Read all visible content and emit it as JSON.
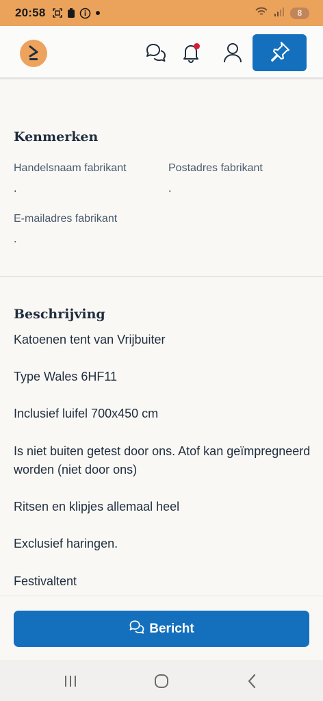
{
  "status_bar": {
    "time": "20:58",
    "battery": "8",
    "icons": [
      "screenshot-icon",
      "lock-icon",
      "info-icon",
      "dot-icon",
      "wifi-icon",
      "signal-icon"
    ]
  },
  "header": {
    "logo": "marktplaats-logo",
    "icons": [
      "chat-icon",
      "bell-icon",
      "user-icon",
      "pin-icon"
    ],
    "colors": {
      "accent": "#1470bd",
      "logo": "#eda25d",
      "notification": "#d81b3a"
    }
  },
  "kenmerken": {
    "title": "Kenmerken",
    "fields": [
      {
        "label": "Handelsnaam fabrikant",
        "value": "."
      },
      {
        "label": "Postadres fabrikant",
        "value": "."
      },
      {
        "label": "E-mailadres fabrikant",
        "value": "."
      }
    ]
  },
  "beschrijving": {
    "title": "Beschrijving",
    "lines": [
      "Katoenen tent van Vrijbuiter",
      "Type Wales 6HF11",
      "Inclusief luifel 700x450 cm",
      "Is niet buiten getest door ons. Atof kan geïmpregneerd worden (niet door ons)",
      "Ritsen en klipjes allemaal heel",
      "Exclusief haringen.",
      "Festivaltent"
    ]
  },
  "action": {
    "message_label": "Bericht"
  },
  "nav": {
    "items": [
      "recent-apps-icon",
      "home-icon",
      "back-icon"
    ]
  }
}
